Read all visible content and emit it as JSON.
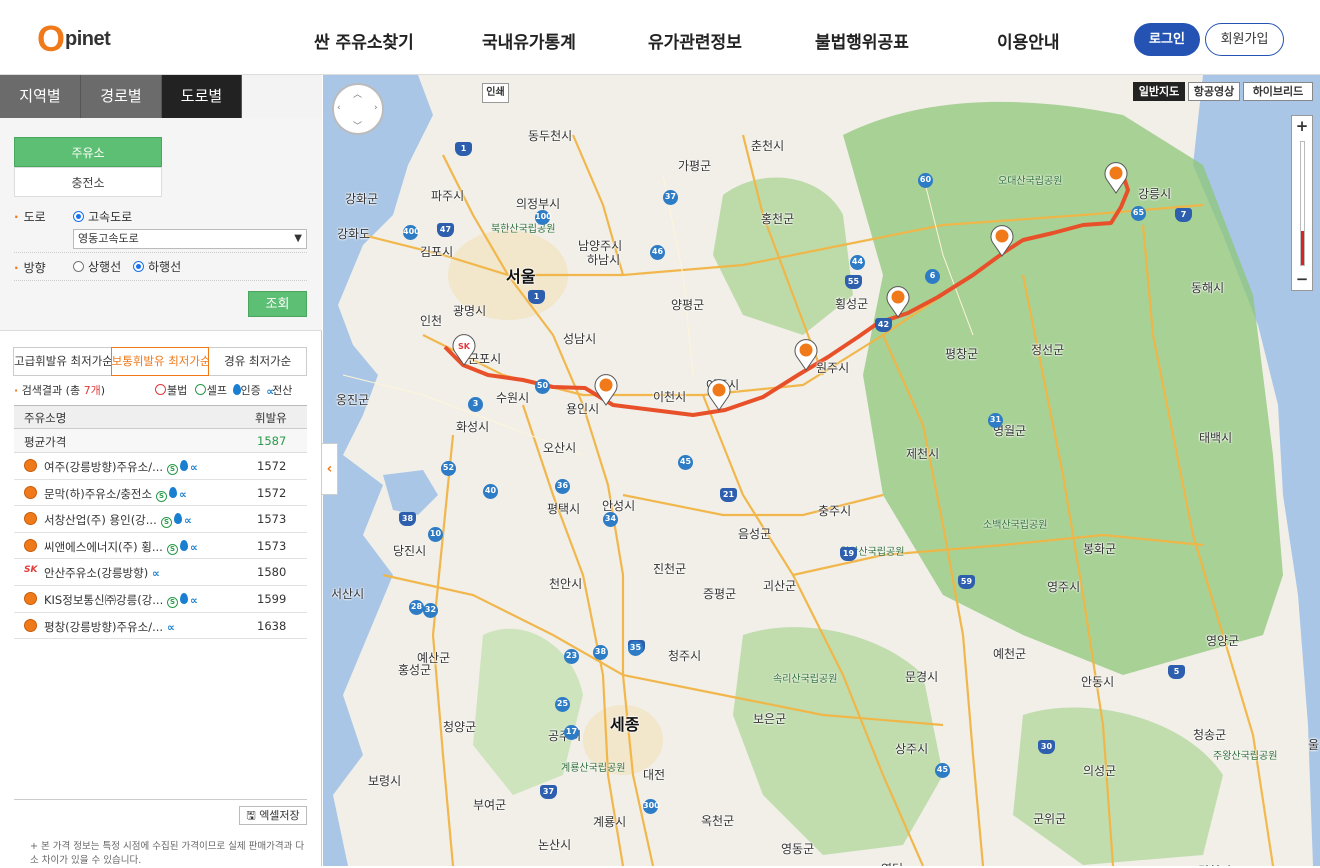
{
  "header": {
    "logo_o": "O",
    "logo_rest": "pinet",
    "nav": [
      "싼 주유소찾기",
      "국내유가통계",
      "유가관련정보",
      "불법행위공표",
      "이용안내"
    ],
    "login": "로그인",
    "join": "회원가입"
  },
  "side": {
    "tabs": [
      "지역별",
      "경로별",
      "도로별"
    ],
    "active_tab": 2,
    "type_buttons": [
      "주유소",
      "충전소"
    ],
    "road_label": "도로",
    "road_option": "고속도로",
    "road_select": "영동고속도로",
    "dir_label": "방향",
    "dir_options": [
      "상행선",
      "하행선"
    ],
    "search_button": "조회",
    "fuel_tabs": [
      "고급휘발유 최저가순",
      "보통휘발유 최저가순",
      "경유 최저가순"
    ],
    "result_prefix": "검색결과 (총 ",
    "result_count": "7개",
    "result_suffix": ")",
    "legend": [
      "불법",
      "셀프",
      "인증",
      "전산"
    ],
    "table": {
      "headers": [
        "주유소명",
        "휘발유"
      ],
      "avg_label": "평균가격",
      "avg_price": "1587",
      "rows": [
        {
          "name": "여주(강릉방향)주유소/...",
          "price": "1572",
          "brand": "ex",
          "self": true,
          "cert": true
        },
        {
          "name": "문막(하)주유소/충전소",
          "price": "1572",
          "brand": "ex",
          "self": true,
          "cert": true
        },
        {
          "name": "서창산업(주) 용인(강...",
          "price": "1573",
          "brand": "ex",
          "self": true,
          "cert": true
        },
        {
          "name": "씨앤에스에너지(주) 횡...",
          "price": "1573",
          "brand": "ex",
          "self": true,
          "cert": true
        },
        {
          "name": "안산주유소(강릉방향)",
          "price": "1580",
          "brand": "sk",
          "self": false,
          "cert": false
        },
        {
          "name": "KIS정보통신㈜강릉(강...",
          "price": "1599",
          "brand": "ex",
          "self": true,
          "cert": true
        },
        {
          "name": "평창(강릉방향)주유소/...",
          "price": "1638",
          "brand": "ex",
          "self": false,
          "cert": false
        }
      ]
    },
    "excel_button": "엑셀저장",
    "note": "본 가격 정보는 특정 시점에 수집된 가격이므로 실제 판매가격과 다소 차이가 있을 수 있습니다."
  },
  "map": {
    "map_types": [
      "일반지도",
      "항공영상",
      "하이브리드"
    ],
    "print": "인쇄",
    "zoom_plus": "+",
    "zoom_minus": "−",
    "zoom_level_fraction": 0.28,
    "colors": {
      "route": "#e8502a",
      "forest": "#8fc77a",
      "sea": "#a9c6e6",
      "road": "#f2b544"
    },
    "cities_big": [
      "서울",
      "세종"
    ],
    "cities": [
      "동두천시",
      "춘천시",
      "가평군",
      "파주시",
      "의정부시",
      "강화군",
      "강화도",
      "김포시",
      "남양주시",
      "홍천군",
      "하남시",
      "광명시",
      "인천",
      "양평군",
      "횡성군",
      "강릉시",
      "동해시",
      "성남시",
      "군포시",
      "원주시",
      "평창군",
      "정선군",
      "수원시",
      "이천시",
      "용인시",
      "여주시",
      "옹진군",
      "화성시",
      "영월군",
      "오산시",
      "태백시",
      "제천시",
      "평택시",
      "안성시",
      "충주시",
      "음성군",
      "당진시",
      "봉화군",
      "진천군",
      "괴산군",
      "서산시",
      "천안시",
      "증평군",
      "영주시",
      "예산군",
      "청주시",
      "홍성군",
      "문경시",
      "예천군",
      "안동시",
      "영양군",
      "청양군",
      "공주시",
      "보은군",
      "상주시",
      "청송군",
      "보령시",
      "대전",
      "의성군",
      "부여군",
      "계룡시",
      "옥천군",
      "군위군",
      "논산시",
      "영동군",
      "김천시",
      "영덕",
      "울진"
    ],
    "parks": [
      "북한산국립공원",
      "오대산국립공원",
      "소백산국립공원",
      "월악산국립공원",
      "속리산국립공원",
      "계룡산국립공원",
      "주왕산국립공원"
    ],
    "shields": [
      "1",
      "400",
      "100",
      "47",
      "37",
      "46",
      "55",
      "60",
      "44",
      "7",
      "65",
      "6",
      "42",
      "50",
      "52",
      "1",
      "3",
      "10",
      "38",
      "40",
      "34",
      "21",
      "38",
      "45",
      "35",
      "17",
      "25",
      "30",
      "45",
      "31",
      "59",
      "36",
      "28",
      "19",
      "32",
      "23",
      "37",
      "300",
      "35",
      "5"
    ]
  }
}
